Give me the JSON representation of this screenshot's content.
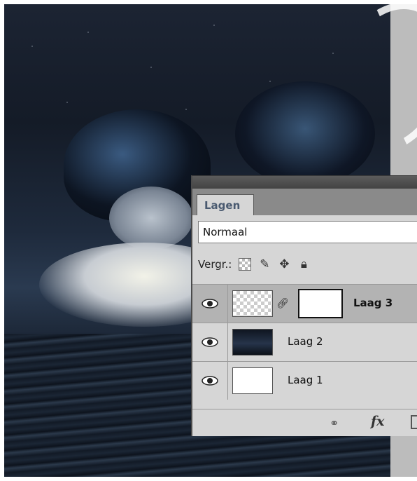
{
  "panel": {
    "tab_label": "Lagen",
    "blend_mode": "Normaal",
    "lock_label": "Vergr.:",
    "lock_icons": [
      "lock-transparent-icon",
      "brush-icon",
      "move-icon",
      "lock-icon"
    ],
    "layers": [
      {
        "name": "Laag 3",
        "selected": true,
        "thumbnail": "transparent",
        "has_mask": true,
        "visible": true
      },
      {
        "name": "Laag 2",
        "selected": false,
        "thumbnail": "dark-image",
        "has_mask": false,
        "visible": true
      },
      {
        "name": "Laag 1",
        "selected": false,
        "thumbnail": "white",
        "has_mask": false,
        "visible": true
      }
    ],
    "footer_icons": [
      "link-icon",
      "fx-icon",
      "mask-icon"
    ],
    "fx_label": "fx"
  }
}
